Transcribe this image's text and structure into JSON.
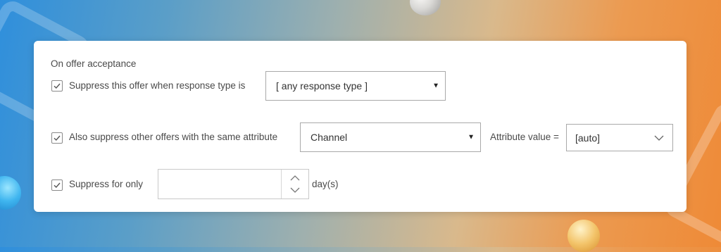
{
  "panel": {
    "section_title": "On offer acceptance",
    "suppress_offer": {
      "checked": true,
      "label": "Suppress this offer when response type is",
      "response_type": "[ any response type ]"
    },
    "suppress_other": {
      "checked": true,
      "label": "Also suppress other offers with the same attribute",
      "attribute": "Channel",
      "attribute_value_label": "Attribute value =",
      "attribute_value": "[auto]"
    },
    "suppress_for": {
      "checked": true,
      "label": "Suppress for only",
      "days_value": "",
      "unit": "day(s)"
    }
  },
  "icons": {
    "checkbox_check": "check-icon",
    "dropdown_arrow": "triangle-down-icon",
    "chevron": "chevron-down-icon",
    "stepper_up": "chevron-up-icon",
    "stepper_down": "chevron-down-icon"
  }
}
